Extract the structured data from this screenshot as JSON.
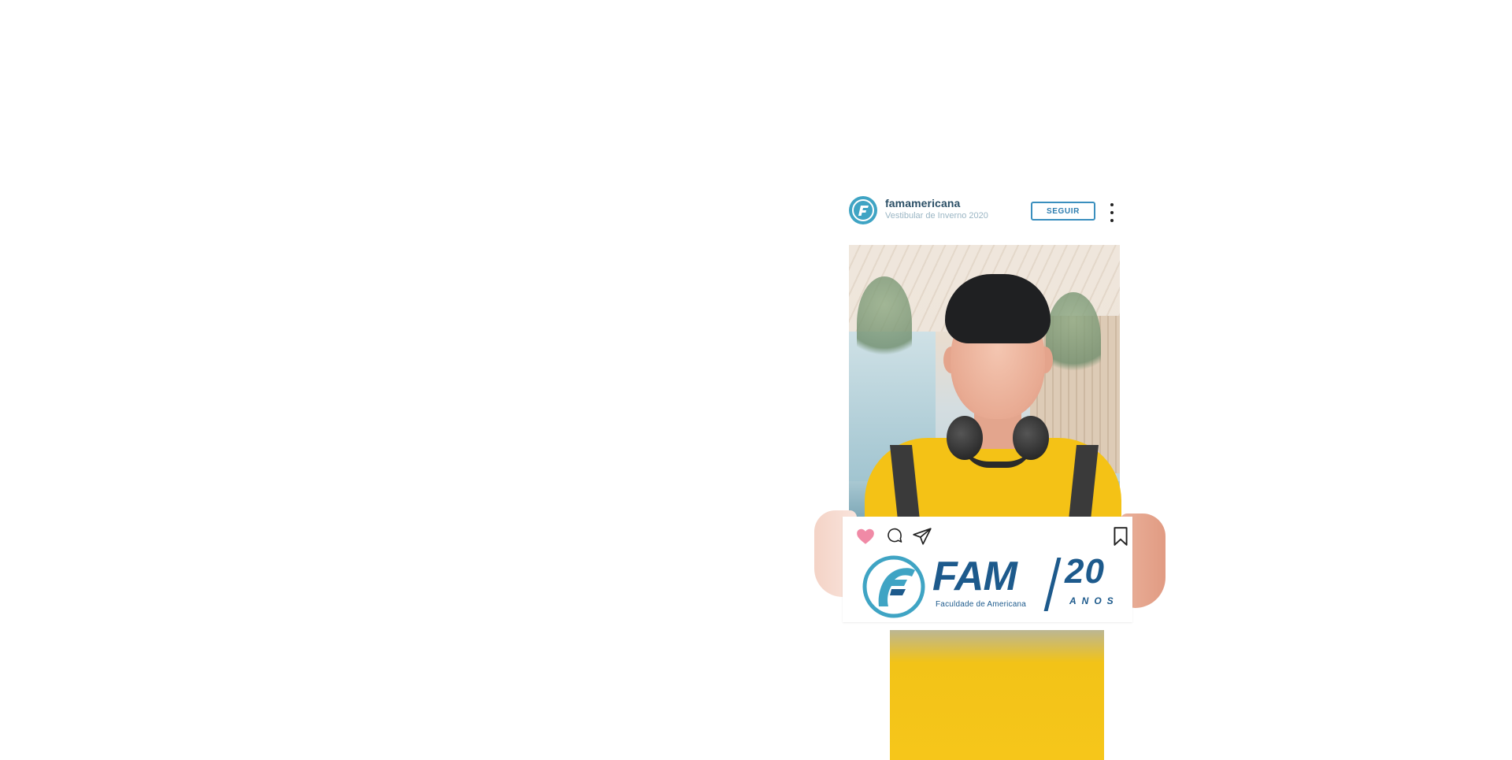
{
  "post": {
    "username": "famamericana",
    "subtitle": "Vestibular de Inverno 2020",
    "follow_label": "SEGUIR"
  },
  "icons": {
    "avatar": "fam-logo-icon",
    "more": "more-vertical-icon",
    "like": "heart-icon",
    "comment": "comment-icon",
    "share": "send-icon",
    "save": "bookmark-icon"
  },
  "logo": {
    "name": "FAM",
    "tagline": "Faculdade de Americana",
    "anniversary": "20",
    "anniversary_unit": "ANOS"
  },
  "colors": {
    "brand_blue": "#1d5a8c",
    "brand_cyan": "#3fa4c4",
    "follow_border": "#3a8fbe",
    "like_pink": "#f08aa6",
    "shirt_yellow": "#f4c216"
  }
}
